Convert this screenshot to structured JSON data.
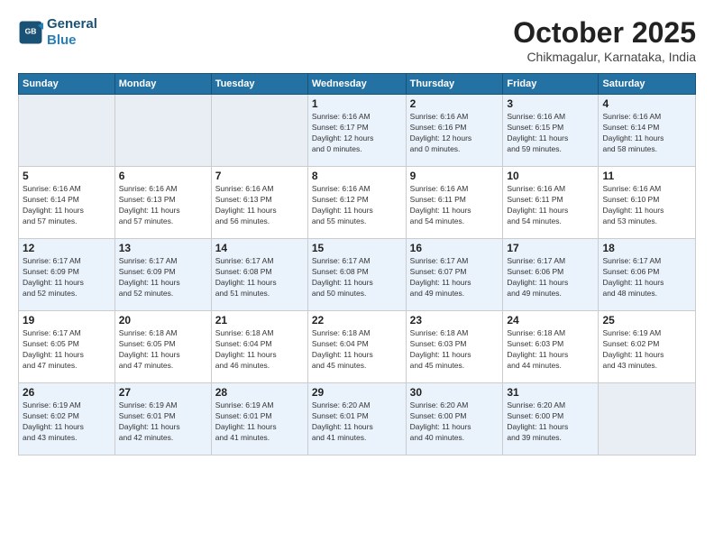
{
  "header": {
    "logo_line1": "General",
    "logo_line2": "Blue",
    "month": "October 2025",
    "location": "Chikmagalur, Karnataka, India"
  },
  "weekdays": [
    "Sunday",
    "Monday",
    "Tuesday",
    "Wednesday",
    "Thursday",
    "Friday",
    "Saturday"
  ],
  "weeks": [
    [
      {
        "day": "",
        "info": ""
      },
      {
        "day": "",
        "info": ""
      },
      {
        "day": "",
        "info": ""
      },
      {
        "day": "1",
        "info": "Sunrise: 6:16 AM\nSunset: 6:17 PM\nDaylight: 12 hours\nand 0 minutes."
      },
      {
        "day": "2",
        "info": "Sunrise: 6:16 AM\nSunset: 6:16 PM\nDaylight: 12 hours\nand 0 minutes."
      },
      {
        "day": "3",
        "info": "Sunrise: 6:16 AM\nSunset: 6:15 PM\nDaylight: 11 hours\nand 59 minutes."
      },
      {
        "day": "4",
        "info": "Sunrise: 6:16 AM\nSunset: 6:14 PM\nDaylight: 11 hours\nand 58 minutes."
      }
    ],
    [
      {
        "day": "5",
        "info": "Sunrise: 6:16 AM\nSunset: 6:14 PM\nDaylight: 11 hours\nand 57 minutes."
      },
      {
        "day": "6",
        "info": "Sunrise: 6:16 AM\nSunset: 6:13 PM\nDaylight: 11 hours\nand 57 minutes."
      },
      {
        "day": "7",
        "info": "Sunrise: 6:16 AM\nSunset: 6:13 PM\nDaylight: 11 hours\nand 56 minutes."
      },
      {
        "day": "8",
        "info": "Sunrise: 6:16 AM\nSunset: 6:12 PM\nDaylight: 11 hours\nand 55 minutes."
      },
      {
        "day": "9",
        "info": "Sunrise: 6:16 AM\nSunset: 6:11 PM\nDaylight: 11 hours\nand 54 minutes."
      },
      {
        "day": "10",
        "info": "Sunrise: 6:16 AM\nSunset: 6:11 PM\nDaylight: 11 hours\nand 54 minutes."
      },
      {
        "day": "11",
        "info": "Sunrise: 6:16 AM\nSunset: 6:10 PM\nDaylight: 11 hours\nand 53 minutes."
      }
    ],
    [
      {
        "day": "12",
        "info": "Sunrise: 6:17 AM\nSunset: 6:09 PM\nDaylight: 11 hours\nand 52 minutes."
      },
      {
        "day": "13",
        "info": "Sunrise: 6:17 AM\nSunset: 6:09 PM\nDaylight: 11 hours\nand 52 minutes."
      },
      {
        "day": "14",
        "info": "Sunrise: 6:17 AM\nSunset: 6:08 PM\nDaylight: 11 hours\nand 51 minutes."
      },
      {
        "day": "15",
        "info": "Sunrise: 6:17 AM\nSunset: 6:08 PM\nDaylight: 11 hours\nand 50 minutes."
      },
      {
        "day": "16",
        "info": "Sunrise: 6:17 AM\nSunset: 6:07 PM\nDaylight: 11 hours\nand 49 minutes."
      },
      {
        "day": "17",
        "info": "Sunrise: 6:17 AM\nSunset: 6:06 PM\nDaylight: 11 hours\nand 49 minutes."
      },
      {
        "day": "18",
        "info": "Sunrise: 6:17 AM\nSunset: 6:06 PM\nDaylight: 11 hours\nand 48 minutes."
      }
    ],
    [
      {
        "day": "19",
        "info": "Sunrise: 6:17 AM\nSunset: 6:05 PM\nDaylight: 11 hours\nand 47 minutes."
      },
      {
        "day": "20",
        "info": "Sunrise: 6:18 AM\nSunset: 6:05 PM\nDaylight: 11 hours\nand 47 minutes."
      },
      {
        "day": "21",
        "info": "Sunrise: 6:18 AM\nSunset: 6:04 PM\nDaylight: 11 hours\nand 46 minutes."
      },
      {
        "day": "22",
        "info": "Sunrise: 6:18 AM\nSunset: 6:04 PM\nDaylight: 11 hours\nand 45 minutes."
      },
      {
        "day": "23",
        "info": "Sunrise: 6:18 AM\nSunset: 6:03 PM\nDaylight: 11 hours\nand 45 minutes."
      },
      {
        "day": "24",
        "info": "Sunrise: 6:18 AM\nSunset: 6:03 PM\nDaylight: 11 hours\nand 44 minutes."
      },
      {
        "day": "25",
        "info": "Sunrise: 6:19 AM\nSunset: 6:02 PM\nDaylight: 11 hours\nand 43 minutes."
      }
    ],
    [
      {
        "day": "26",
        "info": "Sunrise: 6:19 AM\nSunset: 6:02 PM\nDaylight: 11 hours\nand 43 minutes."
      },
      {
        "day": "27",
        "info": "Sunrise: 6:19 AM\nSunset: 6:01 PM\nDaylight: 11 hours\nand 42 minutes."
      },
      {
        "day": "28",
        "info": "Sunrise: 6:19 AM\nSunset: 6:01 PM\nDaylight: 11 hours\nand 41 minutes."
      },
      {
        "day": "29",
        "info": "Sunrise: 6:20 AM\nSunset: 6:01 PM\nDaylight: 11 hours\nand 41 minutes."
      },
      {
        "day": "30",
        "info": "Sunrise: 6:20 AM\nSunset: 6:00 PM\nDaylight: 11 hours\nand 40 minutes."
      },
      {
        "day": "31",
        "info": "Sunrise: 6:20 AM\nSunset: 6:00 PM\nDaylight: 11 hours\nand 39 minutes."
      },
      {
        "day": "",
        "info": ""
      }
    ]
  ],
  "colors": {
    "header_bg": "#2471a3",
    "shaded_row": "#eaf2fb",
    "empty_cell": "#f5f5f5"
  }
}
